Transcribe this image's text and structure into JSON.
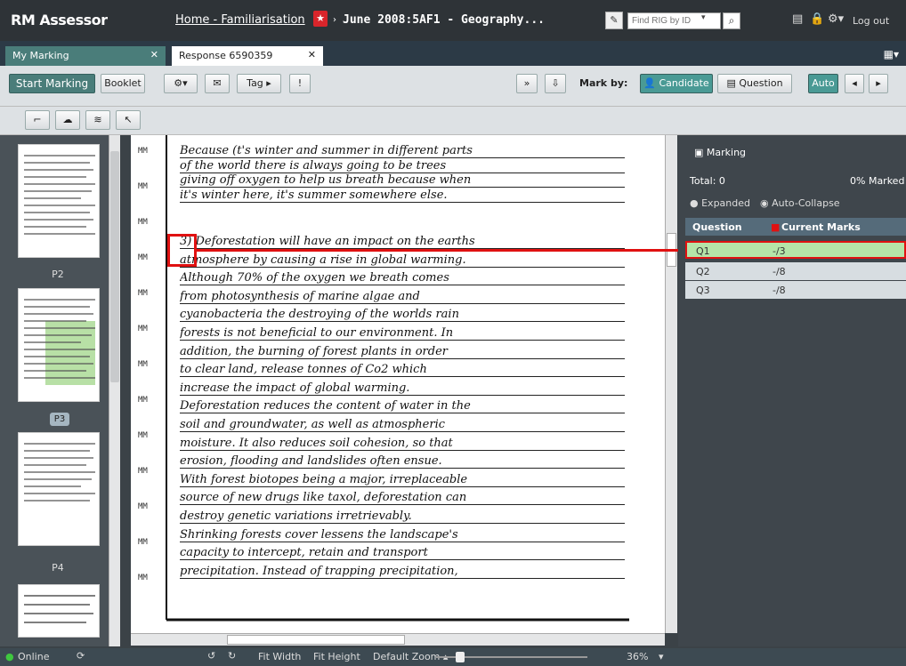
{
  "app": {
    "brand": "RM Assessor",
    "breadcrumb_home": "Home - Familiarisation",
    "breadcrumb_title": "June 2008:5AF1 - Geography...",
    "find_placeholder": "Find RIG by ID",
    "logout": "Log out"
  },
  "tabs": [
    {
      "label": "My Marking"
    },
    {
      "label": "Response 6590359"
    }
  ],
  "toolbar": {
    "start_marking": "Start Marking",
    "booklet": "Booklet",
    "tag": "Tag",
    "mark_by": "Mark by:",
    "candidate": "Candidate",
    "question": "Question",
    "auto": "Auto"
  },
  "thumbnails": [
    {
      "label": "P2"
    },
    {
      "label": "P3"
    },
    {
      "label": "P4"
    }
  ],
  "marking": {
    "title": "Marking",
    "total": "Total: 0",
    "percent": "0% Marked",
    "expanded": "Expanded",
    "auto_collapse": "Auto-Collapse",
    "col_question": "Question",
    "col_marks": "Current Marks",
    "rows": [
      {
        "q": "Q1",
        "m": "-/3"
      },
      {
        "q": "Q2",
        "m": "-/8"
      },
      {
        "q": "Q3",
        "m": "-/8"
      }
    ]
  },
  "status": {
    "online": "Online",
    "fit_width": "Fit Width",
    "fit_height": "Fit Height",
    "default_zoom": "Default Zoom",
    "zoom": "36%"
  },
  "script_lines": [
    "Because (t's winter and summer in different parts",
    "of the world there is always going to be trees",
    "giving off oxygen to help us breath because when",
    "it's winter here, it's summer somewhere else.",
    "3) Deforestation will have an impact on the earths",
    "atmosphere by causing a rise in global warming.",
    "Although 70% of the oxygen we breath comes",
    "from photosynthesis of marine algae and",
    "cyanobacteria the destroying of the worlds rain",
    "forests is not beneficial to our environment. In",
    "addition, the burning of forest plants in order",
    "to clear land, release tonnes of Co2 which",
    "increase the impact of global warming.",
    "Deforestation reduces the content of water in the",
    "soil and groundwater, as well as atmospheric",
    "moisture. It also reduces soil cohesion, so that",
    "erosion, flooding and landslides often ensue.",
    "With forest biotopes being a major, irreplaceable",
    "source of new drugs like taxol, deforestation can",
    "destroy genetic variations irretrievably.",
    "Shrinking forests cover lessens the landscape's",
    "capacity to intercept, retain and transport",
    "precipitation. Instead of trapping precipitation,"
  ]
}
